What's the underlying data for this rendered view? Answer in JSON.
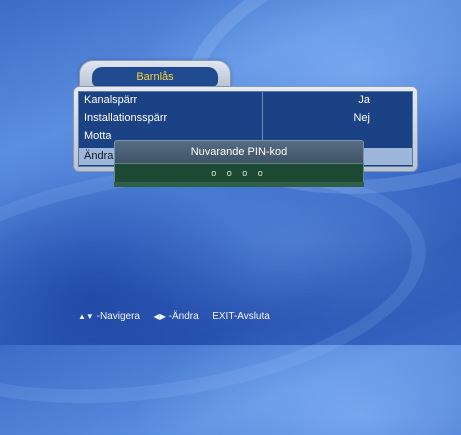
{
  "window": {
    "title": "Barnlås"
  },
  "menu": {
    "rows": [
      {
        "label": "Kanalspärr",
        "value": "Ja"
      },
      {
        "label": "Installationsspärr",
        "value": "Nej"
      },
      {
        "label": "Motta",
        "value": ""
      },
      {
        "label": "Ändra",
        "value": ""
      }
    ],
    "selected_index": 3
  },
  "pin_dialog": {
    "title": "Nuvarande PIN-kod",
    "value": "o o o o"
  },
  "footer": {
    "navigate_icon": "up-down-arrow-icon",
    "navigate_label": "-Navigera",
    "change_icon": "left-right-arrow-icon",
    "change_label": "-Ändra",
    "exit_label": "EXIT-Avsluta"
  },
  "colors": {
    "accent_title": "#f6d23a",
    "table_bg": "#1a4285",
    "selected_row": "#9eb6da",
    "pin_field_bg": "#1e4a35"
  }
}
